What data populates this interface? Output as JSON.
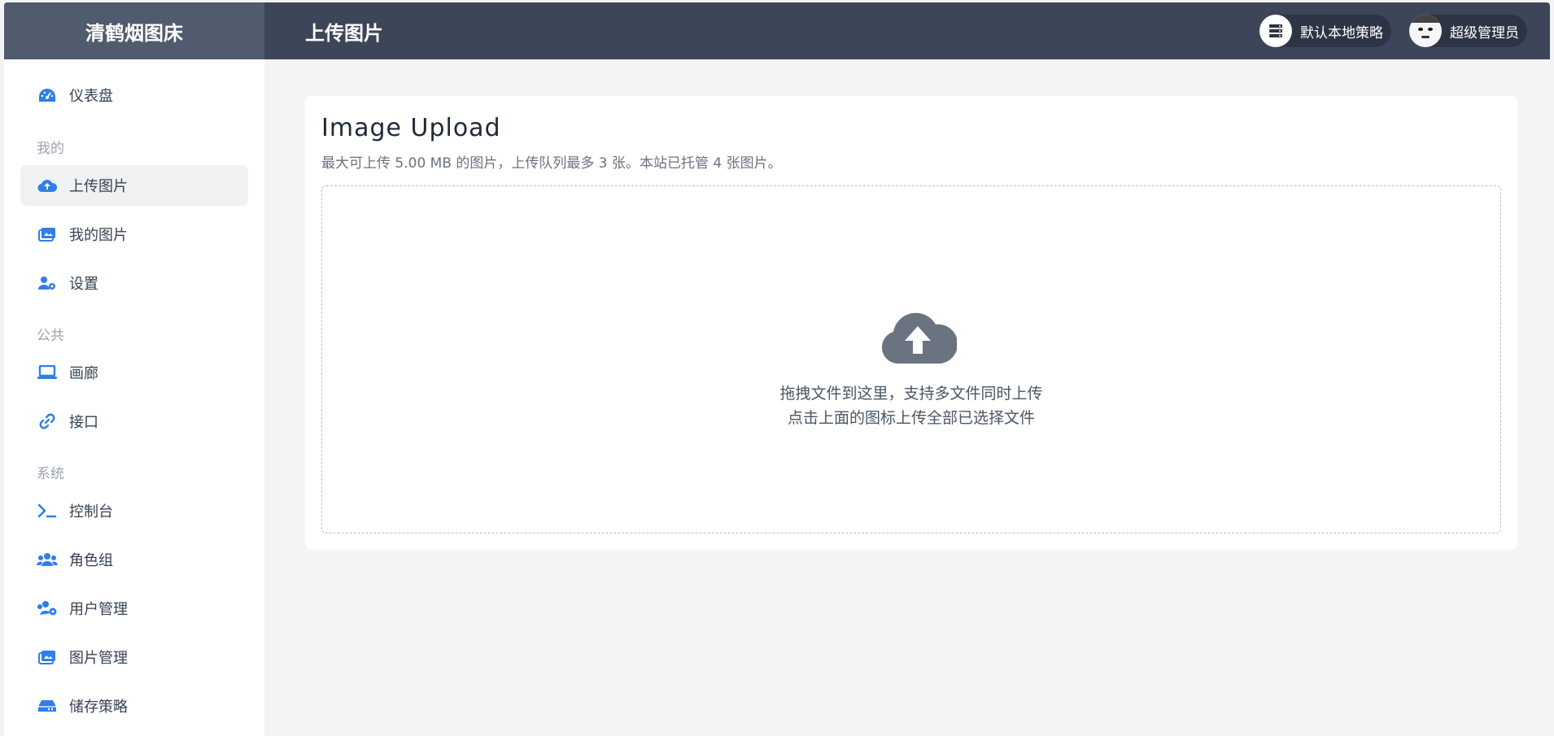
{
  "header": {
    "brand": "清鹤烟图床",
    "page_title": "上传图片",
    "strategy_label": "默认本地策略",
    "user_label": "超级管理员"
  },
  "sidebar": {
    "items": [
      {
        "key": "dashboard",
        "label": "仪表盘",
        "icon": "dashboard-icon"
      },
      {
        "key": "upload",
        "label": "上传图片",
        "icon": "cloud-upload-icon",
        "active": true
      },
      {
        "key": "my-images",
        "label": "我的图片",
        "icon": "images-icon"
      },
      {
        "key": "settings",
        "label": "设置",
        "icon": "user-gear-icon"
      },
      {
        "key": "gallery",
        "label": "画廊",
        "icon": "laptop-icon"
      },
      {
        "key": "api",
        "label": "接口",
        "icon": "link-icon"
      },
      {
        "key": "console",
        "label": "控制台",
        "icon": "terminal-icon"
      },
      {
        "key": "roles",
        "label": "角色组",
        "icon": "users-icon"
      },
      {
        "key": "user-mgmt",
        "label": "用户管理",
        "icon": "users-gear-icon"
      },
      {
        "key": "image-mgmt",
        "label": "图片管理",
        "icon": "images-icon"
      },
      {
        "key": "storage",
        "label": "储存策略",
        "icon": "hard-drive-icon"
      }
    ],
    "sections": {
      "mine": "我的",
      "public": "公共",
      "system": "系统"
    }
  },
  "upload": {
    "title": "Image Upload",
    "subtitle": "最大可上传 5.00 MB 的图片，上传队列最多 3 张。本站已托管 4 张图片。",
    "drop_line1": "拖拽文件到这里，支持多文件同时上传",
    "drop_line2": "点击上面的图标上传全部已选择文件"
  },
  "colors": {
    "accent": "#2f7fe6",
    "header_bg": "#3d4659",
    "brand_bg": "#515b6e",
    "cloud": "#6b7280"
  }
}
